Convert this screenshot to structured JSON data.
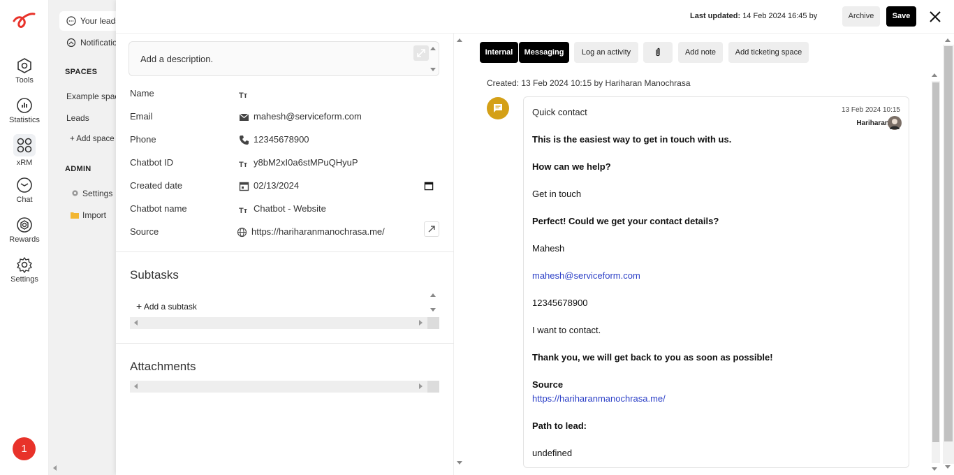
{
  "rail": {
    "items": [
      {
        "label": "Tools",
        "icon": "tools-icon"
      },
      {
        "label": "Statistics",
        "icon": "statistics-icon"
      },
      {
        "label": "xRM",
        "icon": "xrm-icon"
      },
      {
        "label": "Chat",
        "icon": "chat-icon"
      },
      {
        "label": "Rewards",
        "icon": "rewards-icon"
      },
      {
        "label": "Settings",
        "icon": "settings-icon"
      }
    ],
    "badge": "1"
  },
  "sidebar": {
    "your_leads": "Your leads",
    "notifications": "Notificatio",
    "spaces_heading": "SPACES",
    "example_space": "Example spac",
    "leads": "Leads",
    "add_space": "+ Add space",
    "admin_heading": "ADMIN",
    "settings": "Settings",
    "import": "Import"
  },
  "topbar": {
    "last_updated_label": "Last updated:",
    "last_updated_value": "14 Feb 2024 16:45 by",
    "archive": "Archive",
    "save": "Save"
  },
  "details": {
    "description_placeholder": "Add a description.",
    "fields": [
      {
        "label": "Name",
        "value": "",
        "icon": "text-icon"
      },
      {
        "label": "Email",
        "value": "mahesh@serviceform.com",
        "icon": "mail-icon"
      },
      {
        "label": "Phone",
        "value": "12345678900",
        "icon": "phone-icon"
      },
      {
        "label": "Chatbot ID",
        "value": "y8bM2xI0a6stMPuQHyuP",
        "icon": "text-icon"
      },
      {
        "label": "Created date",
        "value": "02/13/2024",
        "icon": "calendar-icon"
      },
      {
        "label": "Chatbot name",
        "value": "Chatbot - Website",
        "icon": "text-icon"
      },
      {
        "label": "Source",
        "value": "https://hariharanmanochrasa.me/",
        "icon": "globe-icon"
      }
    ],
    "subtasks_title": "Subtasks",
    "add_subtask": "Add a subtask",
    "attachments_title": "Attachments"
  },
  "activity": {
    "tabs": [
      "Internal",
      "Messaging",
      "Log an activity",
      "",
      "Add note",
      "Add ticketing space"
    ],
    "created": "Created: 13 Feb 2024 10:15 by Hariharan Manochrasa",
    "card": {
      "title": "Quick contact",
      "date": "13 Feb 2024 10:15",
      "user": "Hariharan",
      "intro_pre": "This is the ",
      "intro_strong": "easiest way",
      "intro_post": " to get in touch with us.",
      "q1": "How can we help?",
      "a1": "Get in touch",
      "q2": "Perfect! Could we get your contact details?",
      "a2": "Mahesh",
      "a3": "mahesh@serviceform.com",
      "a4": "12345678900",
      "a5": "I want to contact.",
      "thanks": "Thank you, we will get back to you as soon as possible!",
      "source_label": "Source",
      "source_url": "https://hariharanmanochrasa.me/",
      "path_label": "Path to lead:",
      "path_value": "undefined"
    }
  }
}
